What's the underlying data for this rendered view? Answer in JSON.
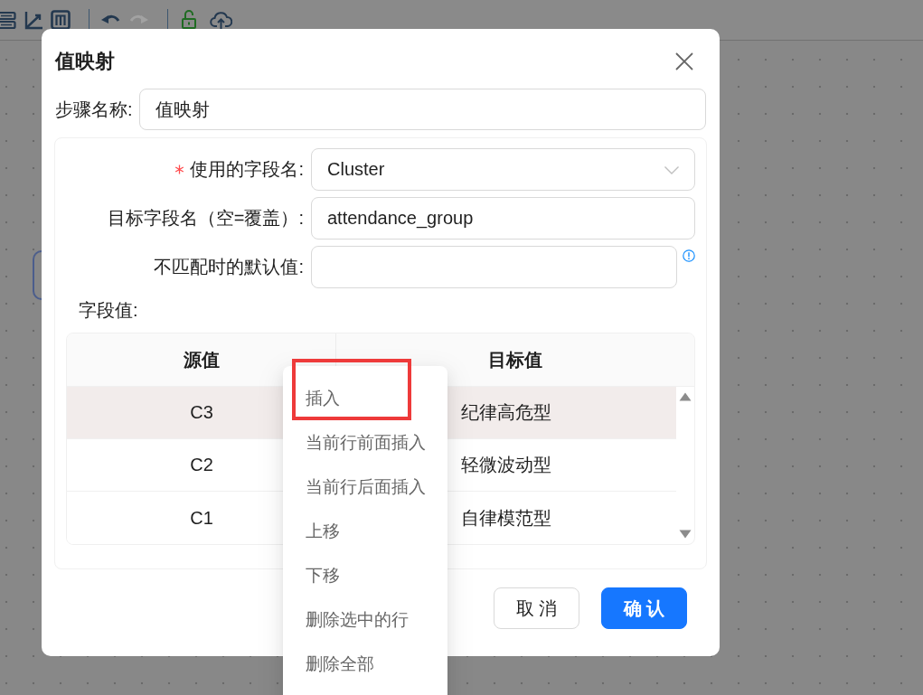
{
  "toolbar": {
    "groups": [
      [
        {
          "kind": "rows"
        },
        {
          "kind": "axis"
        },
        {
          "kind": "columns"
        }
      ],
      [
        {
          "kind": "undo",
          "disabled": false
        },
        {
          "kind": "redo",
          "disabled": true
        }
      ],
      [
        {
          "kind": "lock",
          "locked": false
        },
        {
          "kind": "upload"
        }
      ]
    ]
  },
  "dialog": {
    "title": "值映射",
    "step_name": {
      "label": "步骤名称:",
      "value": "值映射"
    },
    "fields": [
      {
        "kind": "select",
        "label": "使用的字段名:",
        "required": true,
        "value": "Cluster",
        "info": false
      },
      {
        "kind": "input",
        "label": "目标字段名（空=覆盖）:",
        "required": false,
        "value": "attendance_group",
        "info": false
      },
      {
        "kind": "input",
        "label": "不匹配时的默认值:",
        "required": false,
        "info": true
      }
    ],
    "values_label": "字段值:",
    "table": {
      "columns": [
        "源值",
        "目标值"
      ],
      "rows": [
        {
          "cells": [
            "C3",
            "纪律高危型"
          ],
          "selected": true
        },
        {
          "cells": [
            "C2",
            "轻微波动型"
          ],
          "selected": false
        },
        {
          "cells": [
            "C1",
            "自律模范型"
          ],
          "selected": false
        }
      ]
    },
    "buttons": [
      {
        "kind": "default",
        "label": "取 消"
      },
      {
        "kind": "primary",
        "label": "确 认"
      }
    ]
  },
  "context_menu": {
    "items": [
      {
        "label": "插入",
        "highlighted": true
      },
      {
        "label": "当前行前面插入",
        "highlighted": false
      },
      {
        "label": "当前行后面插入",
        "highlighted": false
      },
      {
        "label": "上移",
        "highlighted": false
      },
      {
        "label": "下移",
        "highlighted": false
      },
      {
        "label": "删除选中的行",
        "highlighted": false
      },
      {
        "label": "删除全部",
        "highlighted": false
      }
    ]
  }
}
